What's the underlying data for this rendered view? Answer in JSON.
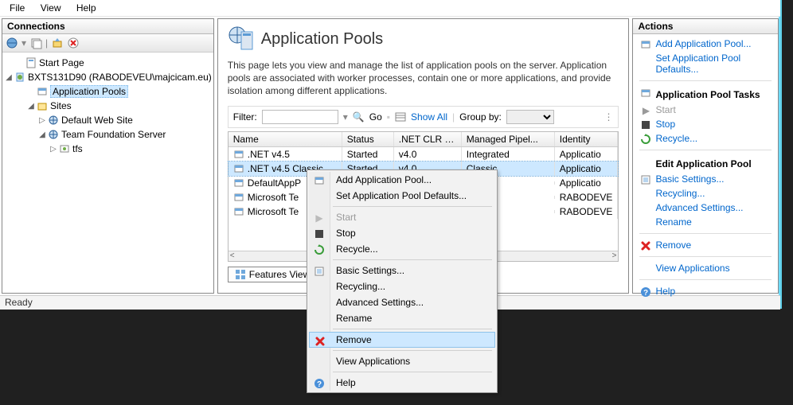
{
  "menubar": {
    "file": "File",
    "view": "View",
    "help": "Help"
  },
  "connections": {
    "title": "Connections",
    "tree": {
      "start_page": "Start Page",
      "server": "BXTS131D90 (RABODEVEU\\majcicam.eu)",
      "app_pools": "Application Pools",
      "sites": "Sites",
      "default_site": "Default Web Site",
      "tfs_server": "Team Foundation Server",
      "tfs": "tfs"
    }
  },
  "center": {
    "title": "Application Pools",
    "description": "This page lets you view and manage the list of application pools on the server. Application pools are associated with worker processes, contain one or more applications, and provide isolation among different applications.",
    "filter_label": "Filter:",
    "go_label": "Go",
    "show_all": "Show All",
    "group_by": "Group by:",
    "columns": {
      "name": "Name",
      "status": "Status",
      "clr": ".NET CLR V...",
      "pipe": "Managed Pipel...",
      "identity": "Identity"
    },
    "rows": [
      {
        "name": ".NET v4.5",
        "status": "Started",
        "clr": "v4.0",
        "pipe": "Integrated",
        "identity": "Applicatio"
      },
      {
        "name": ".NET v4.5 Classic",
        "status": "Started",
        "clr": "v4.0",
        "pipe": "Classic",
        "identity": "Applicatio"
      },
      {
        "name": "DefaultAppP",
        "status": "",
        "clr": "",
        "pipe": "",
        "identity": "Applicatio"
      },
      {
        "name": "Microsoft Te",
        "status": "",
        "clr": "",
        "pipe": "",
        "identity": "RABODEVE"
      },
      {
        "name": "Microsoft Te",
        "status": "",
        "clr": "",
        "pipe": "",
        "identity": "RABODEVE"
      }
    ],
    "features_view": "Features View"
  },
  "context_menu": {
    "add": "Add Application Pool...",
    "defaults": "Set Application Pool Defaults...",
    "start": "Start",
    "stop": "Stop",
    "recycle": "Recycle...",
    "basic": "Basic Settings...",
    "recycling": "Recycling...",
    "advanced": "Advanced Settings...",
    "rename": "Rename",
    "remove": "Remove",
    "view_apps": "View Applications",
    "help": "Help"
  },
  "actions": {
    "title": "Actions",
    "add": "Add Application Pool...",
    "defaults": "Set Application Pool Defaults...",
    "tasks_title": "Application Pool Tasks",
    "start": "Start",
    "stop": "Stop",
    "recycle": "Recycle...",
    "edit_title": "Edit Application Pool",
    "basic": "Basic Settings...",
    "recycling": "Recycling...",
    "advanced": "Advanced Settings...",
    "rename": "Rename",
    "remove": "Remove",
    "view_apps": "View Applications",
    "help": "Help"
  },
  "statusbar": {
    "ready": "Ready"
  },
  "icons": {
    "go_glyph": "▸",
    "dropdown_glyph": "▾"
  }
}
